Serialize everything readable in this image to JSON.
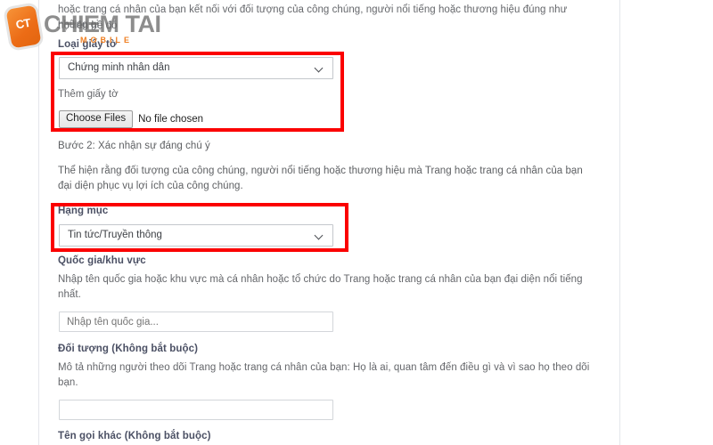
{
  "watermark": {
    "icon_letters": "CT",
    "brand": "CHIEM TAI",
    "tagline": "MOBILE",
    "brand_color": "#ef7f22"
  },
  "intro": {
    "line1": "hoặc trang cá nhân của bạn kết nối với đối tượng của công chúng, người nổi tiếng hoặc thương hiệu đúng như những gì",
    "line2": "họ liên hệ đó"
  },
  "doc_type": {
    "label": "Loại giấy tờ",
    "selected": "Chứng minh nhân dân",
    "options": [
      "Chứng minh nhân dân"
    ],
    "chevron": "chevron-down-icon"
  },
  "upload": {
    "label": "Thêm giấy tờ",
    "button": "Choose Files",
    "status": "No file chosen"
  },
  "step2": {
    "heading": "Bước 2: Xác nhận sự đáng chú ý",
    "description": "Thể hiện rằng đối tượng của công chúng, người nổi tiếng hoặc thương hiệu mà Trang hoặc trang cá nhân của bạn đại diện phục vụ lợi ích của công chúng."
  },
  "category": {
    "label": "Hạng mục",
    "selected": "Tin tức/Truyền thông",
    "options": [
      "Tin tức/Truyền thông"
    ],
    "chevron": "chevron-down-icon"
  },
  "country": {
    "label": "Quốc gia/khu vực",
    "description": "Nhập tên quốc gia hoặc khu vực mà cá nhân hoặc tổ chức do Trang hoặc trang cá nhân của bạn đại diện nổi tiếng nhất.",
    "value": "",
    "placeholder": "Nhập tên quốc gia..."
  },
  "audience": {
    "label": "Đối tượng (Không bắt buộc)",
    "description": "Mô tả những người theo dõi Trang hoặc trang cá nhân của bạn: Họ là ai, quan tâm đến điều gì và vì sao họ theo dõi bạn.",
    "value": "",
    "placeholder": ""
  },
  "other_names": {
    "label": "Tên gọi khác (Không bắt buộc)"
  },
  "annotations": {
    "highlight_color": "#fb0000",
    "boxes": [
      "document-type-and-upload",
      "category-field"
    ]
  }
}
